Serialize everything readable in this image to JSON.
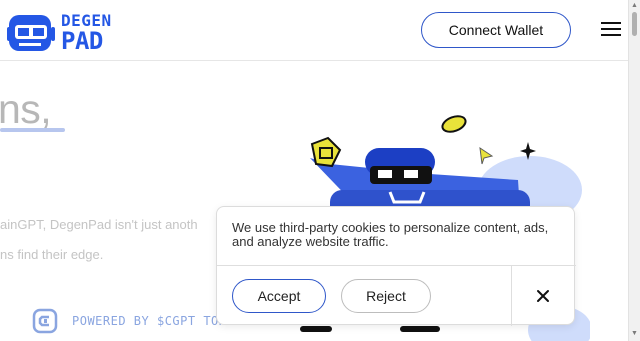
{
  "header": {
    "logo": {
      "line1": "DEGEN",
      "line2": "PAD"
    },
    "connect_wallet_label": "Connect Wallet"
  },
  "hero": {
    "heading_fragment": "ns,",
    "description_lines": [
      "ainGPT, DegenPad isn't just anoth",
      "ns find their edge."
    ]
  },
  "powered_by": "POWERED BY $CGPT TOKE",
  "cookie_banner": {
    "message": "We use third-party cookies to personalize content, ads, and analyze website traffic.",
    "accept_label": "Accept",
    "reject_label": "Reject"
  },
  "colors": {
    "brand_blue": "#2457e5",
    "button_border": "#2f57c9",
    "muted_text": "#b7b7b7"
  },
  "icons": [
    "hamburger-menu-icon",
    "close-icon",
    "degenpad-logo-icon",
    "chaingpt-icon"
  ]
}
